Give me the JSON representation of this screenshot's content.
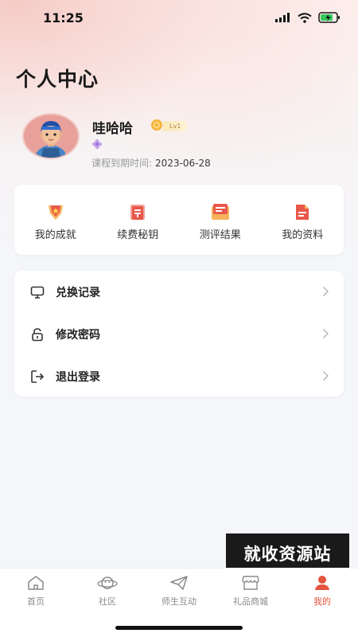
{
  "status_bar": {
    "time": "11:25"
  },
  "page": {
    "title": "个人中心"
  },
  "profile": {
    "name": "哇哈哈",
    "level": "Lv1",
    "expiry_label": "课程到期时间:",
    "expiry_date": "2023-06-28"
  },
  "quick_actions": [
    {
      "label": "我的成就",
      "icon": "achievement-icon"
    },
    {
      "label": "续费秘钥",
      "icon": "renewal-key-icon"
    },
    {
      "label": "测评结果",
      "icon": "assessment-icon"
    },
    {
      "label": "我的资料",
      "icon": "document-icon"
    }
  ],
  "menu": [
    {
      "label": "兑换记录",
      "icon": "monitor-icon"
    },
    {
      "label": "修改密码",
      "icon": "lock-icon"
    },
    {
      "label": "退出登录",
      "icon": "logout-icon"
    }
  ],
  "watermark": "就收资源站",
  "tabs": [
    {
      "label": "首页",
      "icon": "home-icon"
    },
    {
      "label": "社区",
      "icon": "planet-icon"
    },
    {
      "label": "师生互动",
      "icon": "send-icon"
    },
    {
      "label": "礼品商城",
      "icon": "store-icon"
    },
    {
      "label": "我的",
      "icon": "user-icon",
      "active": true
    }
  ],
  "colors": {
    "accent": "#e5543d",
    "badge": "#f4b43a"
  }
}
